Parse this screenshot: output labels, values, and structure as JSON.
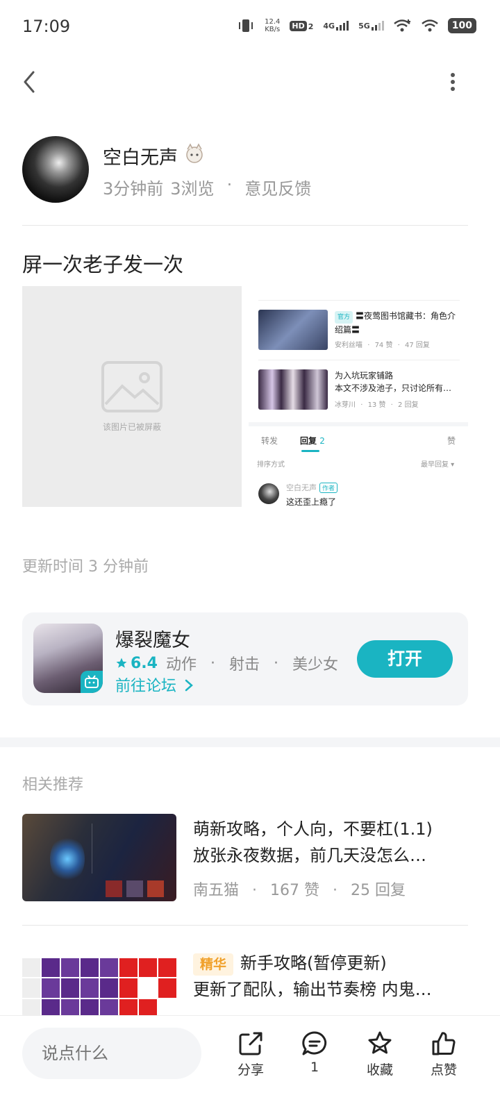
{
  "status_bar": {
    "time": "17:09",
    "net_speed_value": "12.4",
    "net_speed_unit": "KB/s",
    "hd_label": "HD",
    "hd_sub": "2",
    "sig1_label": "4G",
    "sig2_label": "5G",
    "battery": "100"
  },
  "author": {
    "name": "空白无声",
    "time_ago": "3分钟前",
    "views": "3浏览",
    "dot": "·",
    "feedback": "意见反馈"
  },
  "post": {
    "title": "屏一次老子发一次",
    "blocked_caption": "该图片已被屏蔽",
    "update_time": "更新时间 3 分钟前"
  },
  "inset": {
    "item1": {
      "tag": "官方",
      "title": "〓夜莺图书馆藏书：角色介绍篇〓",
      "author": "安利丝喵",
      "likes": "74 赞",
      "replies": "47 回复"
    },
    "item2": {
      "title_line1": "为入坑玩家铺路",
      "title_line2": "本文不涉及池子，只讨论所有…",
      "author": "冰芽川",
      "likes": "13 赞",
      "replies": "2 回复"
    },
    "sep": "·",
    "tab_repost": "转发",
    "tab_reply": "回复",
    "tab_reply_count": "2",
    "tab_like": "赞",
    "sort_label": "排序方式",
    "sort_value": "最早回复",
    "comment_author": "空白无声",
    "comment_author_tag": "作者",
    "comment_text": "这还歪上瘾了"
  },
  "game": {
    "name": "爆裂魔女",
    "rating": "6.4",
    "tags": [
      "动作",
      "射击",
      "美少女"
    ],
    "dot": "·",
    "forum_link": "前往论坛",
    "open_button": "打开"
  },
  "related": {
    "heading": "相关推荐",
    "items": [
      {
        "title_line1": "萌新攻略，个人向，不要杠(1.1)",
        "title_line2": "放张永夜数据，前几天没怎么…",
        "author": "南五猫",
        "likes": "167 赞",
        "replies": "25 回复"
      },
      {
        "tag": "精华",
        "title_line1": "新手攻略(暂停更新)",
        "title_line2": "更新了配队，输出节奏榜 内鬼…"
      }
    ],
    "dot": "·"
  },
  "bottom_bar": {
    "input_placeholder": "说点什么",
    "share": "分享",
    "comments": "1",
    "favorite": "收藏",
    "like": "点赞"
  },
  "colors": {
    "accent": "#1ab4c2",
    "essence": "#f0a02a",
    "muted": "#999999",
    "card_bg": "#f4f5f7"
  }
}
